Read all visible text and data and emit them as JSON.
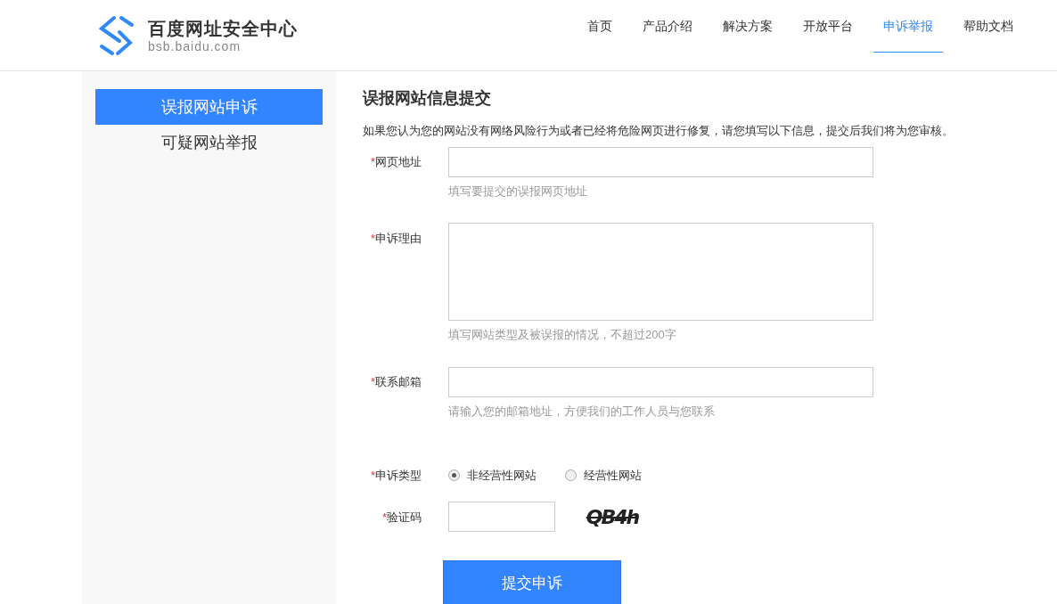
{
  "header": {
    "logo_title": "百度网址安全中心",
    "logo_subtitle": "bsb.baidu.com",
    "nav": [
      {
        "label": "首页",
        "selected": false
      },
      {
        "label": "产品介绍",
        "selected": false
      },
      {
        "label": "解决方案",
        "selected": false
      },
      {
        "label": "开放平台",
        "selected": false
      },
      {
        "label": "申诉举报",
        "selected": true
      },
      {
        "label": "帮助文档",
        "selected": false
      }
    ]
  },
  "sidebar": {
    "items": [
      {
        "label": "误报网站申诉",
        "selected": true
      },
      {
        "label": "可疑网站举报",
        "selected": false
      }
    ]
  },
  "form": {
    "title": "误报网站信息提交",
    "intro": "如果您认为您的网站没有网络风险行为或者已经将危险网页进行修复，请您填写以下信息，提交后我们将为您审核。",
    "fields": [
      {
        "kind": "text",
        "required_mark": "*",
        "label": "网页地址",
        "hint": "填写要提交的误报网页地址"
      },
      {
        "kind": "textarea",
        "required_mark": "*",
        "label": "申诉理由",
        "hint": "填写网站类型及被误报的情况，不超过200字"
      },
      {
        "kind": "text",
        "required_mark": "*",
        "label": "联系邮箱",
        "hint": "请输入您的邮箱地址，方便我们的工作人员与您联系"
      },
      {
        "kind": "radio",
        "required_mark": "*",
        "label": "申诉类型",
        "options": [
          {
            "label": "非经营性网站",
            "selected": true
          },
          {
            "label": "经营性网站",
            "selected": false
          }
        ]
      },
      {
        "kind": "captcha",
        "required_mark": "*",
        "label": "验证码",
        "captcha_text": "QB4h"
      }
    ],
    "submit": "提交申诉"
  }
}
